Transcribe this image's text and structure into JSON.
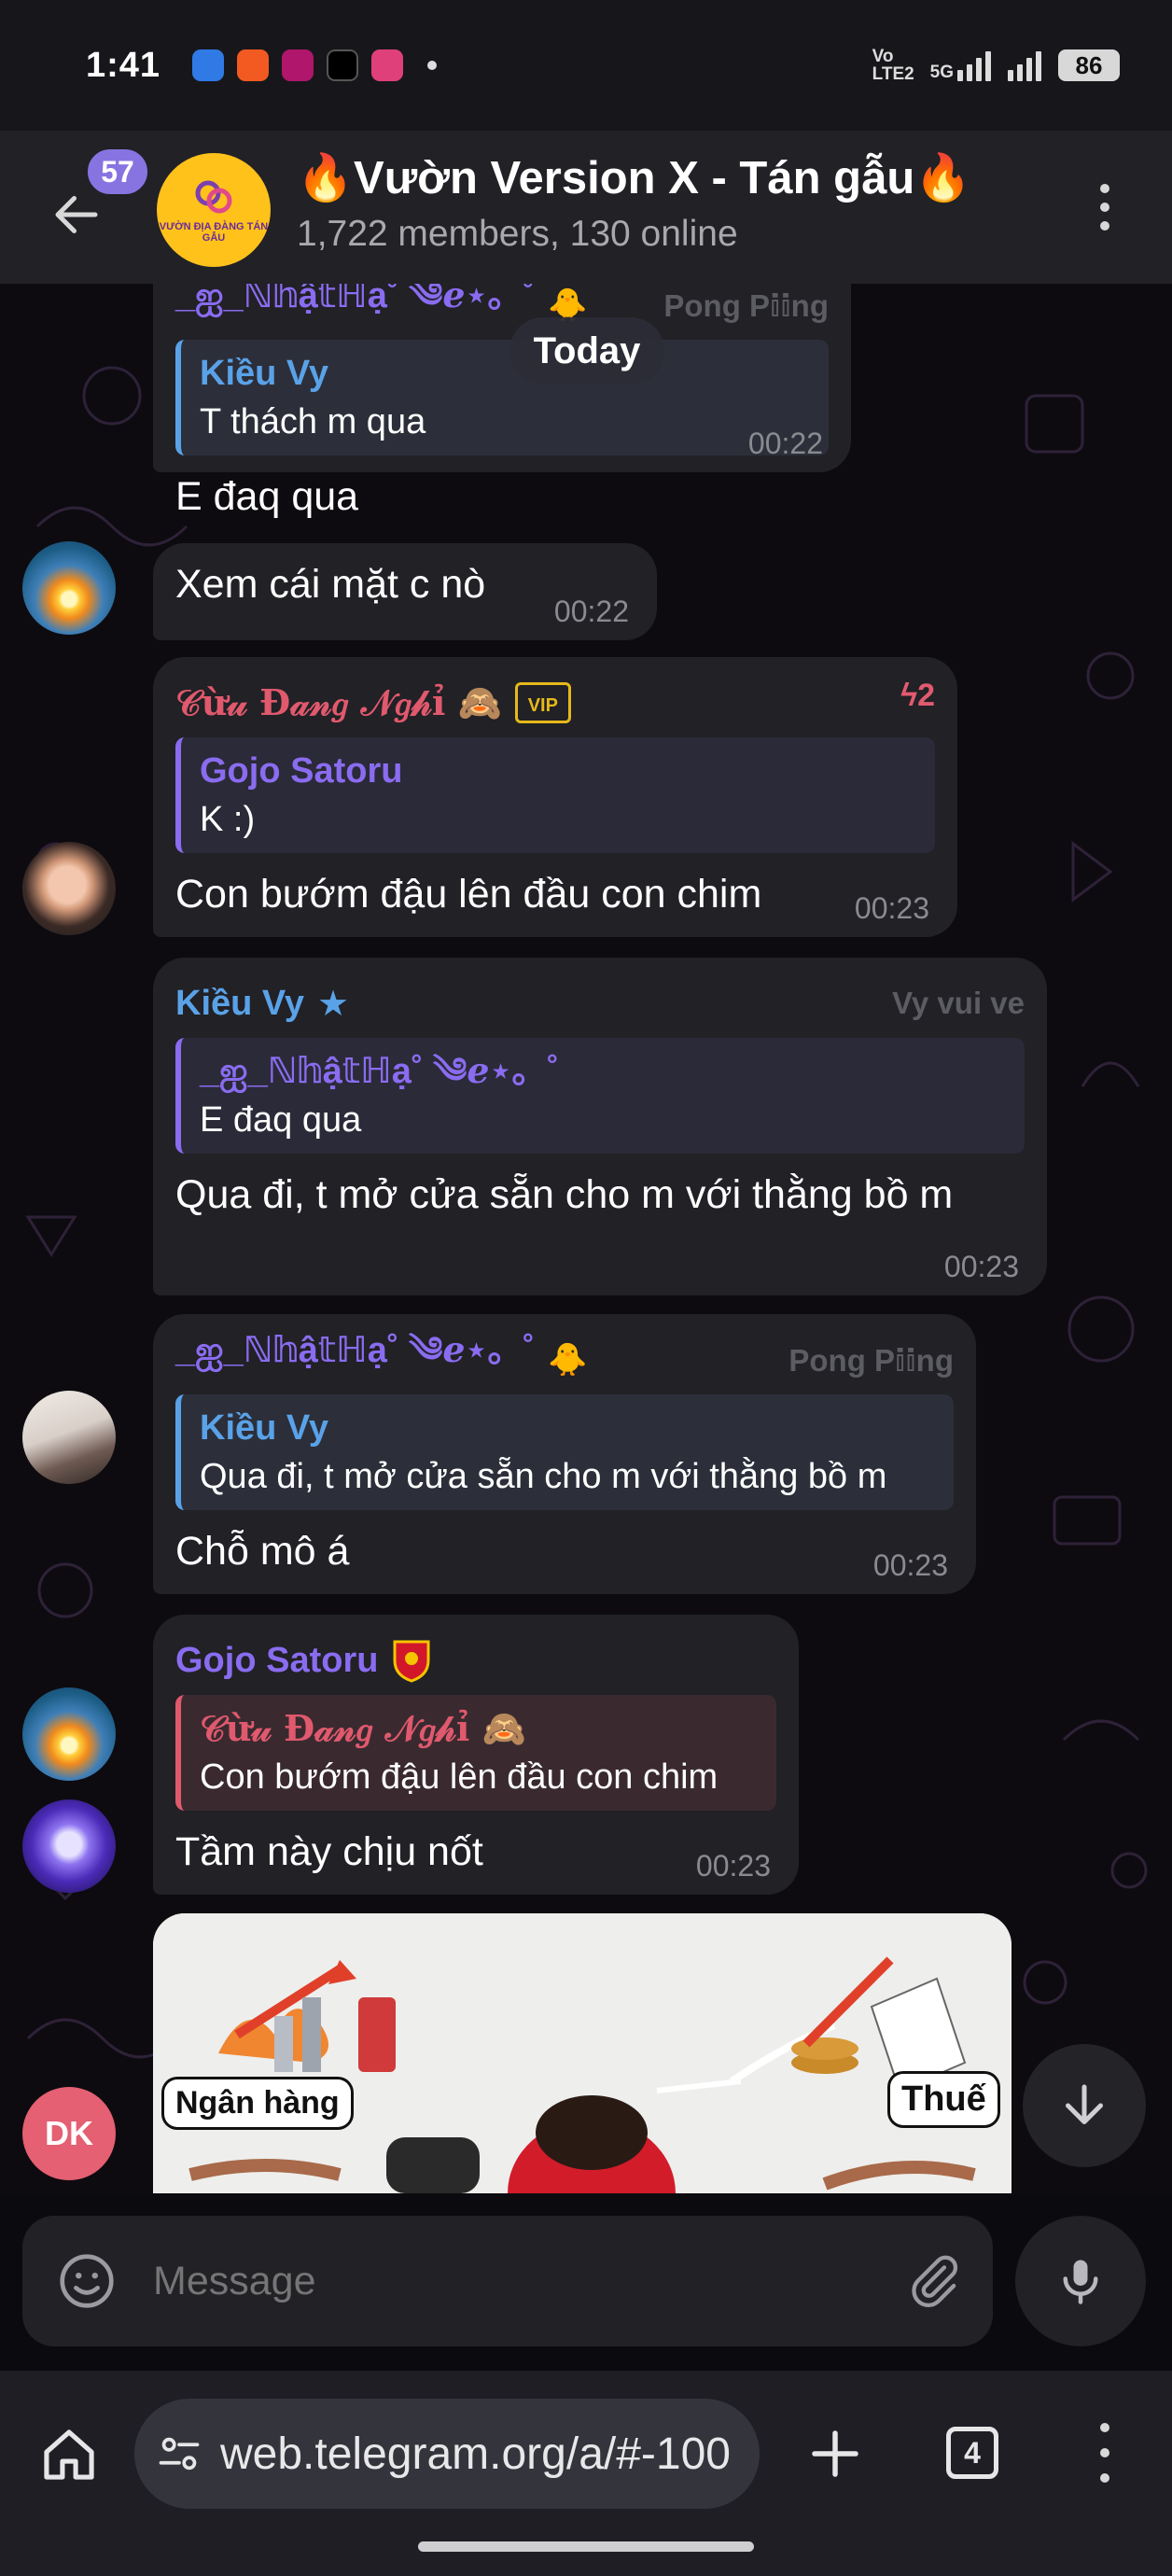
{
  "status_bar": {
    "time": "1:41",
    "network_text": "Vo LTE2",
    "network_type": "5G",
    "battery": "86",
    "app_icons": [
      "wifi-app-icon",
      "shopee-icon",
      "momo-icon",
      "threads-icon",
      "lotte-icon"
    ]
  },
  "header": {
    "unread_count": "57",
    "title": "🔥Vườn Version X - Tán gẫu🔥",
    "subtitle": "1,722 members, 130 online",
    "avatar_text": "VƯỜN ĐỊA ĐÀNG TÁN GẪU"
  },
  "chat": {
    "date_label": "Today",
    "messages": [
      {
        "sender": "_ஐ_ℕ𝕙ậ𝕥ℍạ˚ ༄ℯ⋆。˚",
        "sender_tag": "Pong P𝕚𝕚ng",
        "reply_name": "Kiều Vy",
        "reply_text": "T thách m qua",
        "text": "E đaq qua",
        "time": "00:22"
      },
      {
        "text": "Xem cái mặt c nò",
        "time": "00:22"
      },
      {
        "sender": "𝒞ừ𝓊 Đ𝒶𝓃𝑔 𝒩𝑔𝒽ỉ 🙈",
        "badge": "VIP",
        "forward_count": "2",
        "reply_name": "Gojo Satoru",
        "reply_text": "K :)",
        "text": "Con bướm đậu lên đầu con chim",
        "time": "00:23"
      },
      {
        "sender": "Kiều Vy",
        "sender_tag": "Vy vui ve",
        "reply_name": "_ஐ_ℕ𝕙ậ𝕥ℍạ˚ ༄ℯ⋆。˚",
        "reply_text": "E đaq qua",
        "text": "Qua đi, t mở cửa sẵn cho m với thằng bồ m",
        "time": "00:23"
      },
      {
        "sender": "_ஐ_ℕ𝕙ậ𝕥ℍạ˚ ༄ℯ⋆。˚",
        "sender_tag": "Pong P𝕚𝕚ng",
        "reply_name": "Kiều Vy",
        "reply_text": "Qua đi, t mở cửa sẵn cho m với thằng bồ m",
        "text": "Chỗ mô á",
        "time": "00:23"
      },
      {
        "sender": "Gojo Satoru",
        "reply_name": "𝒞ừ𝓊 Đ𝒶𝓃𝑔 𝒩𝑔𝒽ỉ 🙈",
        "reply_text": "Con bướm đậu lên đầu con chim",
        "text": "Tầm này chịu nốt",
        "time": "00:23"
      }
    ],
    "image_labels": {
      "left": "Ngân hàng",
      "right": "Thuế"
    },
    "dk_avatar": "DK"
  },
  "composer": {
    "placeholder": "Message"
  },
  "browser": {
    "url": "web.telegram.org/a/#-100",
    "tab_count": "4"
  },
  "colors": {
    "accent": "#8774e1",
    "name_purple": "#8a6cf0",
    "name_blue": "#5aa2e8",
    "name_red": "#e0596d",
    "bubble": "#212126"
  }
}
